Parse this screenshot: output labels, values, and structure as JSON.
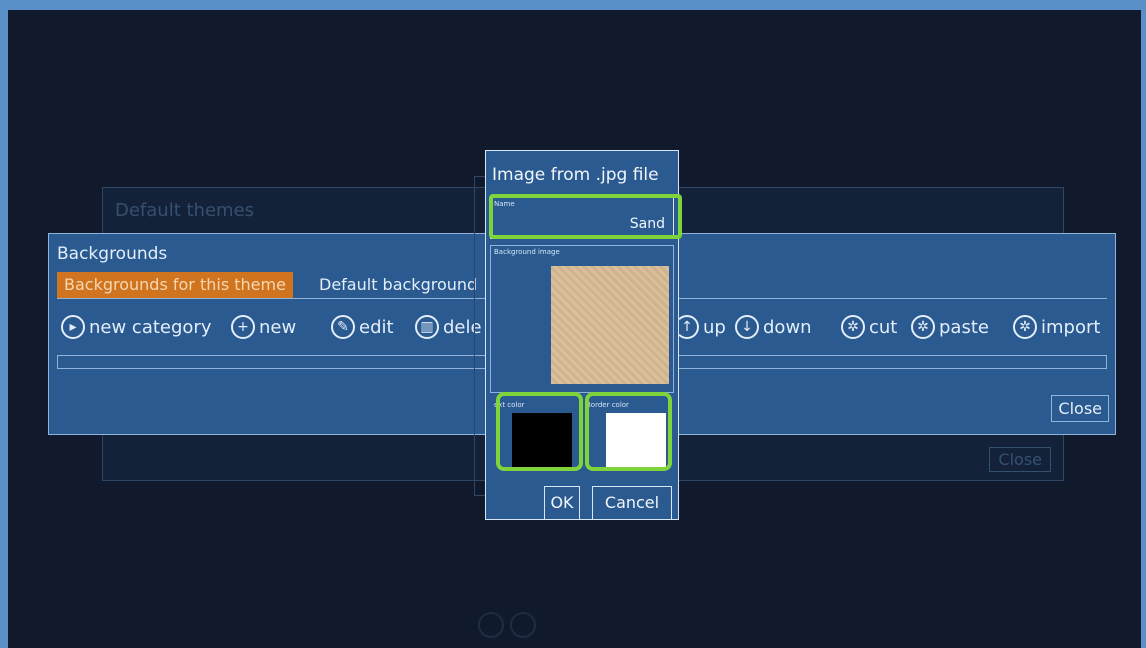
{
  "colors": {
    "frame": "#5b8fc7",
    "screen_bg": "#101a2c",
    "panel": "#2a5a8f",
    "tab_active": "#d1741f",
    "highlight": "#7fd33b"
  },
  "background_panel": {
    "title": "Default themes",
    "close_label": "Close"
  },
  "main_panel": {
    "title": "Backgrounds",
    "tabs": [
      {
        "label": "Backgrounds for this theme",
        "active": true
      },
      {
        "label": "Default background",
        "active": false
      }
    ],
    "toolbar": [
      {
        "icon": "folder-icon",
        "label": "new category"
      },
      {
        "icon": "plus-icon",
        "label": "new"
      },
      {
        "icon": "pencil-icon",
        "label": "edit"
      },
      {
        "icon": "trash-icon",
        "label": "dele"
      },
      {
        "icon": "arrow-up-icon",
        "label": "up"
      },
      {
        "icon": "arrow-down-icon",
        "label": "down"
      },
      {
        "icon": "gear-icon",
        "label": "cut"
      },
      {
        "icon": "gear-icon",
        "label": "paste"
      },
      {
        "icon": "gear-icon",
        "label": "import"
      }
    ],
    "close_label": "Close"
  },
  "dialog": {
    "title": "Image from .jpg file",
    "name_label": "Name",
    "name_value": "Sand",
    "background_image_label": "Background image",
    "text_color_label": "ext color",
    "text_color": "#000000",
    "border_color_label": "Border color",
    "border_color": "#ffffff",
    "ok_label": "OK",
    "cancel_label": "Cancel"
  }
}
